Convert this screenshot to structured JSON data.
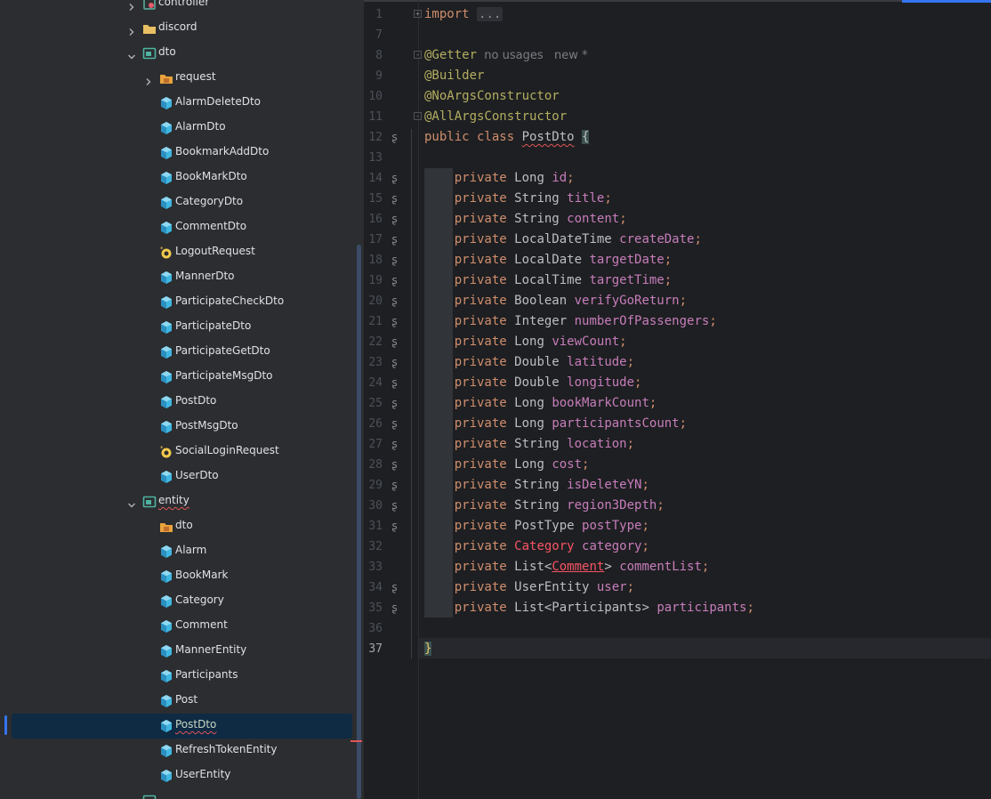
{
  "project_tree": {
    "items": [
      {
        "label": "controller",
        "icon": "package-gear-icon",
        "depth": 1,
        "expanded": false,
        "chevron": "right",
        "has_error": false
      },
      {
        "label": "discord",
        "icon": "folder-icon",
        "depth": 1,
        "expanded": false,
        "chevron": "right",
        "has_error": false
      },
      {
        "label": "dto",
        "icon": "package-icon",
        "depth": 1,
        "expanded": true,
        "chevron": "down",
        "has_error": false
      },
      {
        "label": "request",
        "icon": "package-folder-icon",
        "depth": 2,
        "expanded": false,
        "chevron": "right",
        "has_error": false
      },
      {
        "label": "AlarmDeleteDto",
        "icon": "class-icon",
        "depth": 2,
        "has_error": false
      },
      {
        "label": "AlarmDto",
        "icon": "class-icon",
        "depth": 2,
        "has_error": false
      },
      {
        "label": "BookmarkAddDto",
        "icon": "class-icon",
        "depth": 2,
        "has_error": false
      },
      {
        "label": "BookMarkDto",
        "icon": "class-icon",
        "depth": 2,
        "has_error": false
      },
      {
        "label": "CategoryDto",
        "icon": "class-icon",
        "depth": 2,
        "has_error": false
      },
      {
        "label": "CommentDto",
        "icon": "class-icon",
        "depth": 2,
        "has_error": false
      },
      {
        "label": "LogoutRequest",
        "icon": "record-icon",
        "depth": 2,
        "has_error": false
      },
      {
        "label": "MannerDto",
        "icon": "class-icon",
        "depth": 2,
        "has_error": false
      },
      {
        "label": "ParticipateCheckDto",
        "icon": "class-icon",
        "depth": 2,
        "has_error": false
      },
      {
        "label": "ParticipateDto",
        "icon": "class-icon",
        "depth": 2,
        "has_error": false
      },
      {
        "label": "ParticipateGetDto",
        "icon": "class-icon",
        "depth": 2,
        "has_error": false
      },
      {
        "label": "ParticipateMsgDto",
        "icon": "class-icon",
        "depth": 2,
        "has_error": false
      },
      {
        "label": "PostDto",
        "icon": "class-icon",
        "depth": 2,
        "has_error": false
      },
      {
        "label": "PostMsgDto",
        "icon": "class-icon",
        "depth": 2,
        "has_error": false
      },
      {
        "label": "SocialLoginRequest",
        "icon": "record-icon",
        "depth": 2,
        "has_error": false
      },
      {
        "label": "UserDto",
        "icon": "class-icon",
        "depth": 2,
        "has_error": false
      },
      {
        "label": "entity",
        "icon": "package-icon",
        "depth": 1,
        "expanded": true,
        "chevron": "down",
        "has_error": true
      },
      {
        "label": "dto",
        "icon": "package-folder-icon",
        "depth": 2,
        "has_error": false
      },
      {
        "label": "Alarm",
        "icon": "class-icon",
        "depth": 2,
        "has_error": false
      },
      {
        "label": "BookMark",
        "icon": "class-icon",
        "depth": 2,
        "has_error": false
      },
      {
        "label": "Category",
        "icon": "class-icon",
        "depth": 2,
        "has_error": false
      },
      {
        "label": "Comment",
        "icon": "class-icon",
        "depth": 2,
        "has_error": false
      },
      {
        "label": "MannerEntity",
        "icon": "class-icon",
        "depth": 2,
        "has_error": false
      },
      {
        "label": "Participants",
        "icon": "class-icon",
        "depth": 2,
        "has_error": false
      },
      {
        "label": "Post",
        "icon": "class-icon",
        "depth": 2,
        "has_error": false
      },
      {
        "label": "PostDto",
        "icon": "class-icon",
        "depth": 2,
        "has_error": true,
        "selected": true
      },
      {
        "label": "RefreshTokenEntity",
        "icon": "class-icon",
        "depth": 2,
        "has_error": false
      },
      {
        "label": "UserEntity",
        "icon": "class-icon",
        "depth": 2,
        "has_error": false
      },
      {
        "label": "",
        "icon": "package-icon",
        "depth": 1,
        "expanded": false,
        "chevron": "right",
        "has_error": false
      }
    ]
  },
  "editor": {
    "current_line": "37",
    "lines": [
      {
        "num": "1",
        "fold": "+",
        "tokens": [
          {
            "t": "import",
            "c": "kw"
          },
          {
            "t": " "
          },
          {
            "t": "...",
            "c": "dots"
          }
        ]
      },
      {
        "num": "7",
        "tokens": []
      },
      {
        "num": "8",
        "fold": "-",
        "tokens": [
          {
            "t": "@Getter",
            "c": "an"
          },
          {
            "t": "  no usages   new *",
            "c": "hint"
          }
        ]
      },
      {
        "num": "9",
        "tokens": [
          {
            "t": "@Builder",
            "c": "an"
          }
        ]
      },
      {
        "num": "10",
        "tokens": [
          {
            "t": "@NoArgsConstructor",
            "c": "an"
          }
        ]
      },
      {
        "num": "11",
        "fold": "-",
        "tokens": [
          {
            "t": "@AllArgsConstructor",
            "c": "an"
          }
        ]
      },
      {
        "num": "12",
        "gutter": "ʂ",
        "tokens": [
          {
            "t": "public class ",
            "c": "kw"
          },
          {
            "t": "PostDto",
            "c": "cls-name"
          },
          {
            "t": " "
          },
          {
            "t": "{",
            "c": "brace-hl"
          }
        ]
      },
      {
        "num": "13",
        "tokens": []
      },
      {
        "num": "14",
        "gutter": "ʂ",
        "tokens": [
          {
            "t": "    "
          },
          {
            "t": "private ",
            "c": "kw"
          },
          {
            "t": "Long ",
            "c": "typ"
          },
          {
            "t": "id",
            "c": "fld"
          },
          {
            "t": ";",
            "c": "kw"
          }
        ]
      },
      {
        "num": "15",
        "gutter": "ʂ",
        "tokens": [
          {
            "t": "    "
          },
          {
            "t": "private ",
            "c": "kw"
          },
          {
            "t": "String ",
            "c": "typ"
          },
          {
            "t": "title",
            "c": "fld"
          },
          {
            "t": ";",
            "c": "kw"
          }
        ]
      },
      {
        "num": "16",
        "gutter": "ʂ",
        "tokens": [
          {
            "t": "    "
          },
          {
            "t": "private ",
            "c": "kw"
          },
          {
            "t": "String ",
            "c": "typ"
          },
          {
            "t": "content",
            "c": "fld"
          },
          {
            "t": ";",
            "c": "kw"
          }
        ]
      },
      {
        "num": "17",
        "gutter": "ʂ",
        "tokens": [
          {
            "t": "    "
          },
          {
            "t": "private ",
            "c": "kw"
          },
          {
            "t": "LocalDateTime ",
            "c": "typ"
          },
          {
            "t": "createDate",
            "c": "fld"
          },
          {
            "t": ";",
            "c": "kw"
          }
        ]
      },
      {
        "num": "18",
        "gutter": "ʂ",
        "tokens": [
          {
            "t": "    "
          },
          {
            "t": "private ",
            "c": "kw"
          },
          {
            "t": "LocalDate ",
            "c": "typ"
          },
          {
            "t": "targetDate",
            "c": "fld"
          },
          {
            "t": ";",
            "c": "kw"
          }
        ]
      },
      {
        "num": "19",
        "gutter": "ʂ",
        "tokens": [
          {
            "t": "    "
          },
          {
            "t": "private ",
            "c": "kw"
          },
          {
            "t": "LocalTime ",
            "c": "typ"
          },
          {
            "t": "targetTime",
            "c": "fld"
          },
          {
            "t": ";",
            "c": "kw"
          }
        ]
      },
      {
        "num": "20",
        "gutter": "ʂ",
        "tokens": [
          {
            "t": "    "
          },
          {
            "t": "private ",
            "c": "kw"
          },
          {
            "t": "Boolean ",
            "c": "typ"
          },
          {
            "t": "verifyGoReturn",
            "c": "fld"
          },
          {
            "t": ";",
            "c": "kw"
          }
        ]
      },
      {
        "num": "21",
        "gutter": "ʂ",
        "tokens": [
          {
            "t": "    "
          },
          {
            "t": "private ",
            "c": "kw"
          },
          {
            "t": "Integer ",
            "c": "typ"
          },
          {
            "t": "numberOfPassengers",
            "c": "fld"
          },
          {
            "t": ";",
            "c": "kw"
          }
        ]
      },
      {
        "num": "22",
        "gutter": "ʂ",
        "tokens": [
          {
            "t": "    "
          },
          {
            "t": "private ",
            "c": "kw"
          },
          {
            "t": "Long ",
            "c": "typ"
          },
          {
            "t": "viewCount",
            "c": "fld"
          },
          {
            "t": ";",
            "c": "kw"
          }
        ]
      },
      {
        "num": "23",
        "gutter": "ʂ",
        "tokens": [
          {
            "t": "    "
          },
          {
            "t": "private ",
            "c": "kw"
          },
          {
            "t": "Double ",
            "c": "typ"
          },
          {
            "t": "latitude",
            "c": "fld"
          },
          {
            "t": ";",
            "c": "kw"
          }
        ]
      },
      {
        "num": "24",
        "gutter": "ʂ",
        "tokens": [
          {
            "t": "    "
          },
          {
            "t": "private ",
            "c": "kw"
          },
          {
            "t": "Double ",
            "c": "typ"
          },
          {
            "t": "longitude",
            "c": "fld"
          },
          {
            "t": ";",
            "c": "kw"
          }
        ]
      },
      {
        "num": "25",
        "gutter": "ʂ",
        "tokens": [
          {
            "t": "    "
          },
          {
            "t": "private ",
            "c": "kw"
          },
          {
            "t": "Long ",
            "c": "typ"
          },
          {
            "t": "bookMarkCount",
            "c": "fld"
          },
          {
            "t": ";",
            "c": "kw"
          }
        ]
      },
      {
        "num": "26",
        "gutter": "ʂ",
        "tokens": [
          {
            "t": "    "
          },
          {
            "t": "private ",
            "c": "kw"
          },
          {
            "t": "Long ",
            "c": "typ"
          },
          {
            "t": "participantsCount",
            "c": "fld"
          },
          {
            "t": ";",
            "c": "kw"
          }
        ]
      },
      {
        "num": "27",
        "gutter": "ʂ",
        "tokens": [
          {
            "t": "    "
          },
          {
            "t": "private ",
            "c": "kw"
          },
          {
            "t": "String ",
            "c": "typ"
          },
          {
            "t": "location",
            "c": "fld"
          },
          {
            "t": ";",
            "c": "kw"
          }
        ]
      },
      {
        "num": "28",
        "gutter": "ʂ",
        "tokens": [
          {
            "t": "    "
          },
          {
            "t": "private ",
            "c": "kw"
          },
          {
            "t": "Long ",
            "c": "typ"
          },
          {
            "t": "cost",
            "c": "fld"
          },
          {
            "t": ";",
            "c": "kw"
          }
        ]
      },
      {
        "num": "29",
        "gutter": "ʂ",
        "tokens": [
          {
            "t": "    "
          },
          {
            "t": "private ",
            "c": "kw"
          },
          {
            "t": "String ",
            "c": "typ"
          },
          {
            "t": "isDeleteYN",
            "c": "fld"
          },
          {
            "t": ";",
            "c": "kw"
          }
        ]
      },
      {
        "num": "30",
        "gutter": "ʂ",
        "tokens": [
          {
            "t": "    "
          },
          {
            "t": "private ",
            "c": "kw"
          },
          {
            "t": "String ",
            "c": "typ"
          },
          {
            "t": "region3Depth",
            "c": "fld"
          },
          {
            "t": ";",
            "c": "kw"
          }
        ]
      },
      {
        "num": "31",
        "gutter": "ʂ",
        "tokens": [
          {
            "t": "    "
          },
          {
            "t": "private ",
            "c": "kw"
          },
          {
            "t": "PostType ",
            "c": "typ"
          },
          {
            "t": "postType",
            "c": "fld"
          },
          {
            "t": ";",
            "c": "kw"
          }
        ]
      },
      {
        "num": "32",
        "tokens": [
          {
            "t": "    "
          },
          {
            "t": "private ",
            "c": "kw"
          },
          {
            "t": "Category",
            "c": "err-type"
          },
          {
            "t": " "
          },
          {
            "t": "category",
            "c": "fld"
          },
          {
            "t": ";",
            "c": "kw"
          }
        ]
      },
      {
        "num": "33",
        "tokens": [
          {
            "t": "    "
          },
          {
            "t": "private ",
            "c": "kw"
          },
          {
            "t": "List<",
            "c": "typ"
          },
          {
            "t": "Comment",
            "c": "err-ul"
          },
          {
            "t": "> ",
            "c": "typ"
          },
          {
            "t": "commentList",
            "c": "fld"
          },
          {
            "t": ";",
            "c": "kw"
          }
        ]
      },
      {
        "num": "34",
        "gutter": "ʂ",
        "tokens": [
          {
            "t": "    "
          },
          {
            "t": "private ",
            "c": "kw"
          },
          {
            "t": "UserEntity ",
            "c": "typ"
          },
          {
            "t": "user",
            "c": "fld"
          },
          {
            "t": ";",
            "c": "kw"
          }
        ]
      },
      {
        "num": "35",
        "gutter": "ʂ",
        "tokens": [
          {
            "t": "    "
          },
          {
            "t": "private ",
            "c": "kw"
          },
          {
            "t": "List<Participants> ",
            "c": "typ"
          },
          {
            "t": "participants",
            "c": "fld"
          },
          {
            "t": ";",
            "c": "kw"
          }
        ]
      },
      {
        "num": "36",
        "tokens": []
      },
      {
        "num": "37",
        "tokens": [
          {
            "t": "}",
            "c": "caret-brace"
          }
        ]
      }
    ]
  },
  "colors": {
    "tree_bg": "#2b2d30",
    "editor_bg": "#1e1f22",
    "selection_bg": "#0f2a43",
    "accent": "#3574f0",
    "keyword": "#cf8e6d",
    "annotation": "#b3ae60",
    "field": "#c77dbb",
    "error": "#f75464",
    "class_icon": "#40b6e0"
  }
}
